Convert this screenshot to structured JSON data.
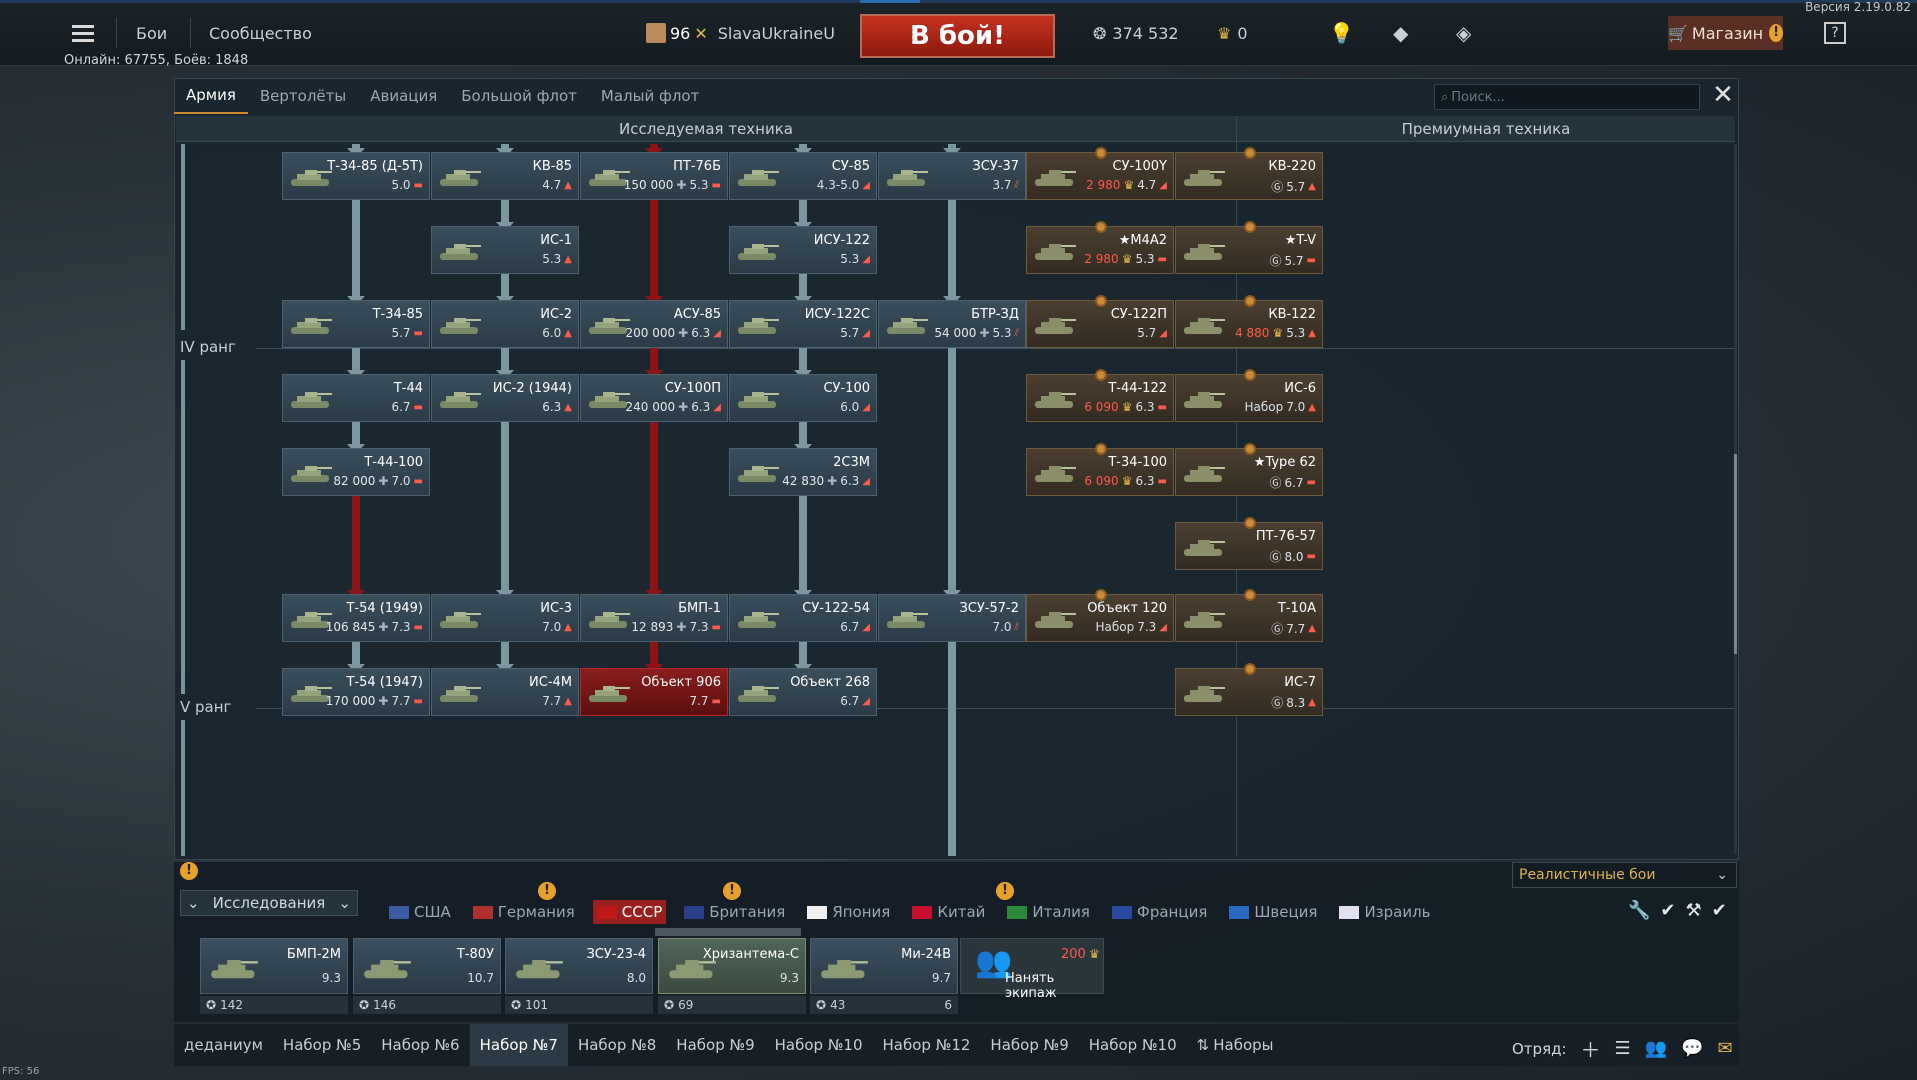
{
  "app": {
    "version": "Версия 2.19.0.82",
    "online": "Онлайн: 67755, Боёв: 1848",
    "fps": "FPS: 56"
  },
  "topbar": {
    "battles": "Бои",
    "community": "Сообщество",
    "level": "96",
    "nickname": "SlavaUkraineU",
    "battle_button": "В бой!",
    "silver": "374 532",
    "gold": "0",
    "shop": "Магазин",
    "shop_warning": "!",
    "help": "?"
  },
  "tabs": [
    "Армия",
    "Вертолёты",
    "Авиация",
    "Большой флот",
    "Малый флот"
  ],
  "search": {
    "placeholder": "Поиск..."
  },
  "headers": {
    "researched": "Исследуемая техника",
    "premium": "Премиумная техника"
  },
  "ranks": {
    "iv": "IV ранг",
    "v": "V ранг"
  },
  "vehicles": [
    {
      "name": "Т-34-85 (Д-5Т)",
      "info": "5.0",
      "cost": "",
      "cls": "▬"
    },
    {
      "name": "КВ-85",
      "info": "4.7",
      "cost": "",
      "cls": "▲"
    },
    {
      "name": "ПТ-76Б",
      "info": "5.3",
      "cost": "150 000",
      "cls": "▬"
    },
    {
      "name": "СУ-85",
      "info": "4.3-5.0",
      "cost": "",
      "cls": "◢"
    },
    {
      "name": "ЗСУ-37",
      "info": "3.7",
      "cost": "",
      "cls": "⫽"
    },
    {
      "name": "ИС-1",
      "info": "5.3",
      "cost": "",
      "cls": "▲"
    },
    {
      "name": "ИСУ-122",
      "info": "5.3",
      "cost": "",
      "cls": "◢"
    },
    {
      "name": "Т-34-85",
      "info": "5.7",
      "cost": "",
      "cls": "▬"
    },
    {
      "name": "ИС-2",
      "info": "6.0",
      "cost": "",
      "cls": "▲"
    },
    {
      "name": "АСУ-85",
      "info": "6.3",
      "cost": "200 000",
      "cls": "◢"
    },
    {
      "name": "ИСУ-122С",
      "info": "5.7",
      "cost": "",
      "cls": "◢"
    },
    {
      "name": "БТР-ЗД",
      "info": "5.3",
      "cost": "54 000",
      "cls": "⫽"
    },
    {
      "name": "Т-44",
      "info": "6.7",
      "cost": "",
      "cls": "▬"
    },
    {
      "name": "ИС-2 (1944)",
      "info": "6.3",
      "cost": "",
      "cls": "▲"
    },
    {
      "name": "СУ-100П",
      "info": "6.3",
      "cost": "240 000",
      "cls": "◢"
    },
    {
      "name": "СУ-100",
      "info": "6.0",
      "cost": "",
      "cls": "◢"
    },
    {
      "name": "Т-44-100",
      "info": "7.0",
      "cost": "82 000",
      "cls": "▬"
    },
    {
      "name": "2С3М",
      "info": "6.3",
      "cost": "42 830",
      "cls": "◢"
    },
    {
      "name": "Т-54 (1949)",
      "info": "7.3",
      "cost": "106 845",
      "cls": "▬"
    },
    {
      "name": "ИС-3",
      "info": "7.0",
      "cost": "",
      "cls": "▲"
    },
    {
      "name": "БМП-1",
      "info": "7.3",
      "cost": "12 893",
      "cls": "▬"
    },
    {
      "name": "СУ-122-54",
      "info": "6.7",
      "cost": "",
      "cls": "◢"
    },
    {
      "name": "ЗСУ-57-2",
      "info": "7.0",
      "cost": "",
      "cls": "⫽"
    },
    {
      "name": "Т-54 (1947)",
      "info": "7.7",
      "cost": "170 000",
      "cls": "▬"
    },
    {
      "name": "ИС-4М",
      "info": "7.7",
      "cost": "",
      "cls": "▲"
    },
    {
      "name": "Объект 906",
      "info": "7.7",
      "cost": "",
      "cls": "▬"
    },
    {
      "name": "Объект 268",
      "info": "6.7",
      "cost": "",
      "cls": "◢"
    }
  ],
  "premium": [
    {
      "name": "СУ-100Y",
      "gold": "2 980",
      "info": "4.7",
      "cls": "◢"
    },
    {
      "name": "КВ-220",
      "gold": "Ⓖ",
      "info": "5.7",
      "cls": "▲"
    },
    {
      "name": "★М4А2",
      "gold": "2 980",
      "info": "5.3",
      "cls": "▬"
    },
    {
      "name": "★T-V",
      "gold": "Ⓖ",
      "info": "5.7",
      "cls": "▬"
    },
    {
      "name": "СУ-122П",
      "gold": "",
      "info": "5.7",
      "cls": "◢"
    },
    {
      "name": "КВ-122",
      "gold": "4 880",
      "info": "5.3",
      "cls": "▲"
    },
    {
      "name": "Т-44-122",
      "gold": "6 090",
      "info": "6.3",
      "cls": "▬"
    },
    {
      "name": "ИС-6",
      "gold": "Набор",
      "info": "7.0",
      "cls": "▲"
    },
    {
      "name": "Т-34-100",
      "gold": "6 090",
      "info": "6.3",
      "cls": "▬"
    },
    {
      "name": "★Type 62",
      "gold": "Ⓖ",
      "info": "6.7",
      "cls": "▬"
    },
    {
      "name": "ПТ-76-57",
      "gold": "Ⓖ",
      "info": "8.0",
      "cls": "▬"
    },
    {
      "name": "Объект 120",
      "gold": "Набор",
      "info": "7.3",
      "cls": "◢"
    },
    {
      "name": "Т-10А",
      "gold": "Ⓖ",
      "info": "7.7",
      "cls": "▲"
    },
    {
      "name": "ИС-7",
      "gold": "Ⓖ",
      "info": "8.3",
      "cls": "▲"
    }
  ],
  "mode": "Реалистичные бои",
  "research_button": "Исследования",
  "nations": [
    "США",
    "Германия",
    "СССР",
    "Британия",
    "Япония",
    "Китай",
    "Италия",
    "Франция",
    "Швеция",
    "Израиль"
  ],
  "crew": [
    {
      "name": "БМП-2М",
      "br": "9.3",
      "count": "142"
    },
    {
      "name": "Т-80У",
      "br": "10.7",
      "count": "146"
    },
    {
      "name": "ЗСУ-23-4",
      "br": "8.0",
      "count": "101"
    },
    {
      "name": "Хризантема-С",
      "br": "9.3",
      "count": "69"
    },
    {
      "name": "Ми-24В",
      "br": "9.7",
      "count": "43",
      "extra": "6"
    }
  ],
  "hire_crew": {
    "cost": "200",
    "label": "Нанять экипаж"
  },
  "presets": [
    "деданиум",
    "Набор №5",
    "Набор №6",
    "Набор №7",
    "Набор №8",
    "Набор №9",
    "Набор №10",
    "Набор №12",
    "Набор №9",
    "Набор №10",
    "Наборы"
  ],
  "squad": "Отряд:",
  "colors": {
    "accent": "#d08a2d",
    "research_line": "#7c979f",
    "red_line": "#8c1416",
    "battle": "#c5311f"
  }
}
